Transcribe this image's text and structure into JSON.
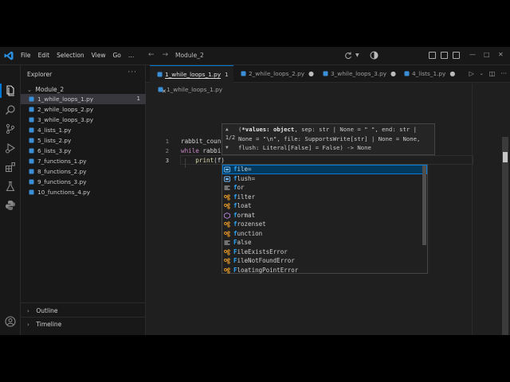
{
  "titlebar": {
    "menu": [
      "File",
      "Edit",
      "Selection",
      "View",
      "Go"
    ],
    "menu_more": "…",
    "search": "Module_2",
    "nav_back": "←",
    "nav_forward": "→"
  },
  "sidebar": {
    "title": "Explorer",
    "more": "···",
    "folder": "Module_2",
    "files": [
      {
        "name": "1_while_loops_1.py",
        "badge": "1"
      },
      {
        "name": "2_while_loops_2.py",
        "badge": ""
      },
      {
        "name": "3_while_loops_3.py",
        "badge": ""
      },
      {
        "name": "4_lists_1.py",
        "badge": ""
      },
      {
        "name": "5_lists_2.py",
        "badge": ""
      },
      {
        "name": "6_lists_3.py",
        "badge": ""
      },
      {
        "name": "7_functions_1.py",
        "badge": ""
      },
      {
        "name": "8_functions_2.py",
        "badge": ""
      },
      {
        "name": "9_functions_3.py",
        "badge": ""
      },
      {
        "name": "10_functions_4.py",
        "badge": ""
      }
    ],
    "outline": "Outline",
    "timeline": "Timeline"
  },
  "tabs": [
    {
      "label": "1_while_loops_1.py",
      "count": "1",
      "active": true
    },
    {
      "label": "2_while_loops_2.py",
      "dot": "●"
    },
    {
      "label": "3_while_loops_3.py",
      "dot": "●"
    },
    {
      "label": "4_lists_1.py",
      "dot": "●"
    }
  ],
  "breadcrumb": "1_while_loops_1.py",
  "code": {
    "line_numbers": [
      "1",
      "2",
      "3"
    ],
    "line1": "rabbit_coun",
    "line2_kw": "while",
    "line2_rest": " rabbi",
    "line3_fn": "print",
    "line3_rest": "(f)"
  },
  "signature": {
    "counter": "1/2",
    "line1_pre": "(",
    "line1_param": "*values: object",
    "line1_post": ", sep: str | None = \" \", end: str |",
    "line2": "None = \"\\n\", file: SupportsWrite[str] | None = None,",
    "line3": "flush: Literal[False] = False) -> None"
  },
  "suggestions": [
    {
      "label": "file=",
      "kind": "variable"
    },
    {
      "label": "flush=",
      "kind": "variable"
    },
    {
      "label": "for",
      "kind": "keyword"
    },
    {
      "label": "filter",
      "kind": "class"
    },
    {
      "label": "float",
      "kind": "class"
    },
    {
      "label": "format",
      "kind": "function"
    },
    {
      "label": "frozenset",
      "kind": "class"
    },
    {
      "label": "function",
      "kind": "class"
    },
    {
      "label": "False",
      "kind": "keyword"
    },
    {
      "label": "FileExistsError",
      "kind": "class"
    },
    {
      "label": "FileNotFoundError",
      "kind": "class"
    },
    {
      "label": "FloatingPointError",
      "kind": "class"
    }
  ],
  "colors": {
    "accent": "#0078d4",
    "python_icon": "#3a8fd6",
    "match": "#2aaaff"
  }
}
